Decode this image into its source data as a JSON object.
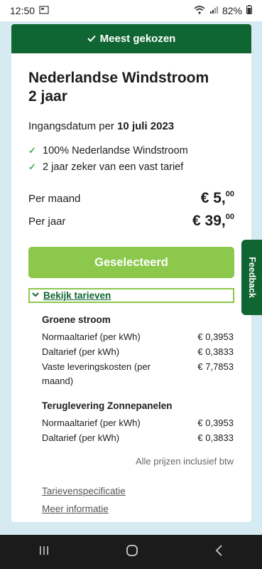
{
  "status": {
    "time": "12:50",
    "battery": "82%"
  },
  "card": {
    "header": "Meest gekozen",
    "title_line1": "Nederlandse Windstroom",
    "title_line2": "2 jaar",
    "start_label": "Ingangsdatum per",
    "start_date": "10 juli 2023",
    "features": [
      "100% Nederlandse Windstroom",
      "2 jaar zeker van een vast tarief"
    ],
    "per_month_label": "Per maand",
    "per_month_amount": "€ 5,",
    "per_month_cents": "00",
    "per_year_label": "Per jaar",
    "per_year_amount": "€ 39,",
    "per_year_cents": "00",
    "select_button": "Geselecteerd",
    "toggle_label": "Bekijk tarieven"
  },
  "rates": {
    "green": {
      "title": "Groene stroom",
      "rows": [
        {
          "label": "Normaaltarief (per kWh)",
          "value": "€ 0,3953"
        },
        {
          "label": "Daltarief (per kWh)",
          "value": "€ 0,3833"
        },
        {
          "label": "Vaste leveringskosten (per maand)",
          "value": "€ 7,7853"
        }
      ]
    },
    "solar": {
      "title": "Teruglevering Zonnepanelen",
      "rows": [
        {
          "label": "Normaaltarief (per kWh)",
          "value": "€ 0,3953"
        },
        {
          "label": "Daltarief (per kWh)",
          "value": "€ 0,3833"
        }
      ]
    },
    "vat_note": "Alle prijzen inclusief btw"
  },
  "links": {
    "spec": "Tarievenspecificatie",
    "more": "Meer informatie"
  },
  "feedback": "Feedback",
  "colors": {
    "brand_green": "#0f6632",
    "accent_green": "#8cc84b",
    "background": "#d6eaf1"
  },
  "icons": [
    "wifi-icon",
    "signal-icon",
    "battery-icon",
    "check-icon",
    "chevron-down-icon",
    "recent-apps-icon",
    "home-icon",
    "back-icon"
  ]
}
